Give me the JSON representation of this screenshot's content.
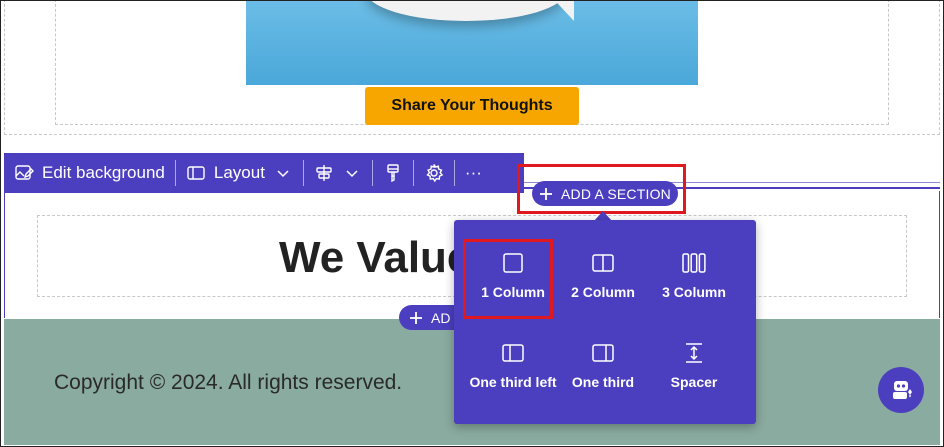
{
  "hero": {
    "cta_label": "Share Your Thoughts"
  },
  "toolbar": {
    "edit_background": "Edit background",
    "layout": "Layout",
    "more": "···"
  },
  "add_section": {
    "label": "ADD A SECTION",
    "label_partial": "AD"
  },
  "section_heading": "We Value",
  "popup": {
    "options": [
      {
        "label": "1 Column",
        "icon": "one-column-icon"
      },
      {
        "label": "2 Column",
        "icon": "two-column-icon"
      },
      {
        "label": "3 Column",
        "icon": "three-column-icon"
      },
      {
        "label": "One third left",
        "icon": "one-third-left-icon"
      },
      {
        "label": "One third",
        "icon": "one-third-icon"
      },
      {
        "label": "Spacer",
        "icon": "spacer-icon"
      }
    ]
  },
  "footer": {
    "copyright": "Copyright © 2024. All rights reserved."
  },
  "colors": {
    "accent": "#4b3fbf",
    "cta": "#f7a600",
    "footer_bg": "#8aaba0",
    "highlight": "#e0181f"
  }
}
